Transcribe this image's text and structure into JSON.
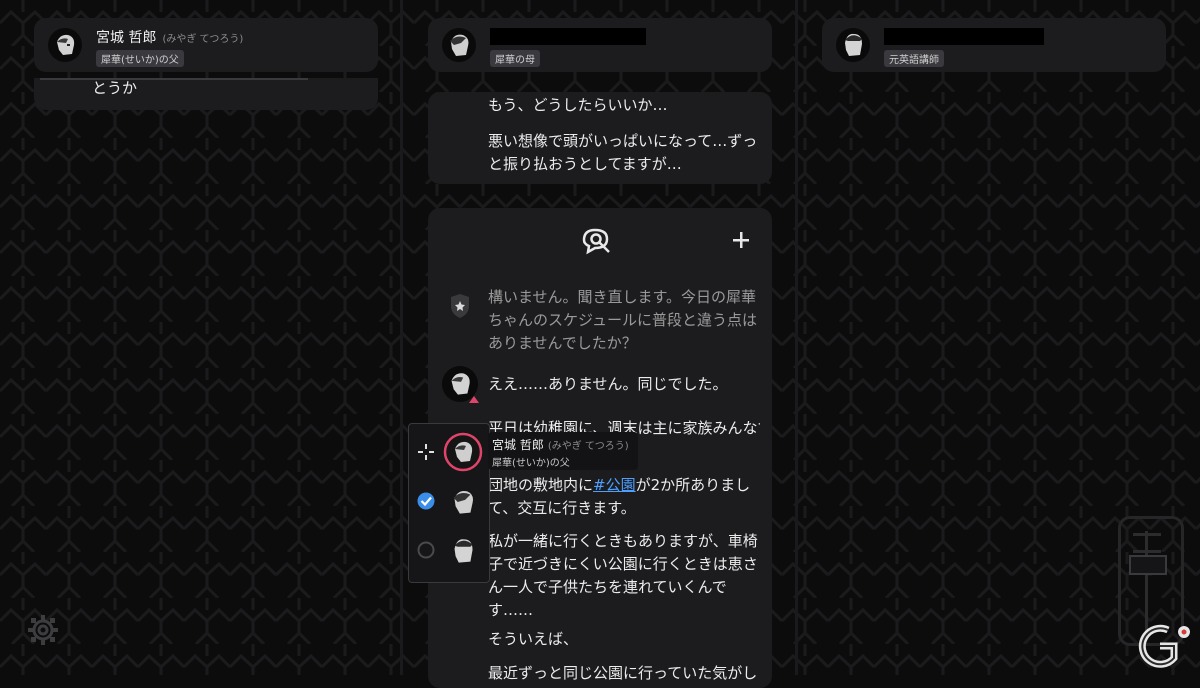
{
  "columns": [
    {
      "name": "宮城 哲郎",
      "reading": "(みやぎ てつろう)",
      "role": "犀華(せいか)の父",
      "fragment": "とうか"
    },
    {
      "role": "犀華の母",
      "messages": [
        "もう、どうしたらいいか…",
        "悪い想像で頭がいっぱいになって…ずっと振り払おうとしてますが…"
      ]
    },
    {
      "role": "元英語講師"
    }
  ],
  "chat": {
    "icons": {
      "search": "search-chat-icon",
      "add": "plus-icon"
    },
    "investigator_msg": "構いません。聞き直します。今日の犀華ちゃんのスケジュールに普段と違う点はありませんでしたか？",
    "reply1": "ええ……ありません。同じでした。",
    "reply2": "平日は幼稚園に、週末は主に家族みんなで",
    "reply3_pre": "団地の敷地内に",
    "reply3_tag": "#公園",
    "reply3_post": "が2か所ありまして、交互に行きます。",
    "reply4": "私が一緒に行くときもありますが、車椅子で近づきにくい公園に行くときは恵さん一人で子供たちを連れていくんです……",
    "reply5": "そういえば、",
    "reply6": "最近ずっと同じ公園に行っていた気がし"
  },
  "speaker_popup": {
    "options": [
      "move-icon",
      "checked-radio",
      "empty-radio"
    ],
    "selected_index": 1,
    "tooltip_name": "宮城 哲郎",
    "tooltip_reading": "(みやぎ てつろう)",
    "tooltip_role": "犀華(せいか)の父"
  },
  "colors": {
    "background": "#0c0c0d",
    "card": "#1c1c1f",
    "hashtag": "#4ea0ff",
    "highlight_ring": "#e0446a",
    "check": "#3b8ee8"
  }
}
